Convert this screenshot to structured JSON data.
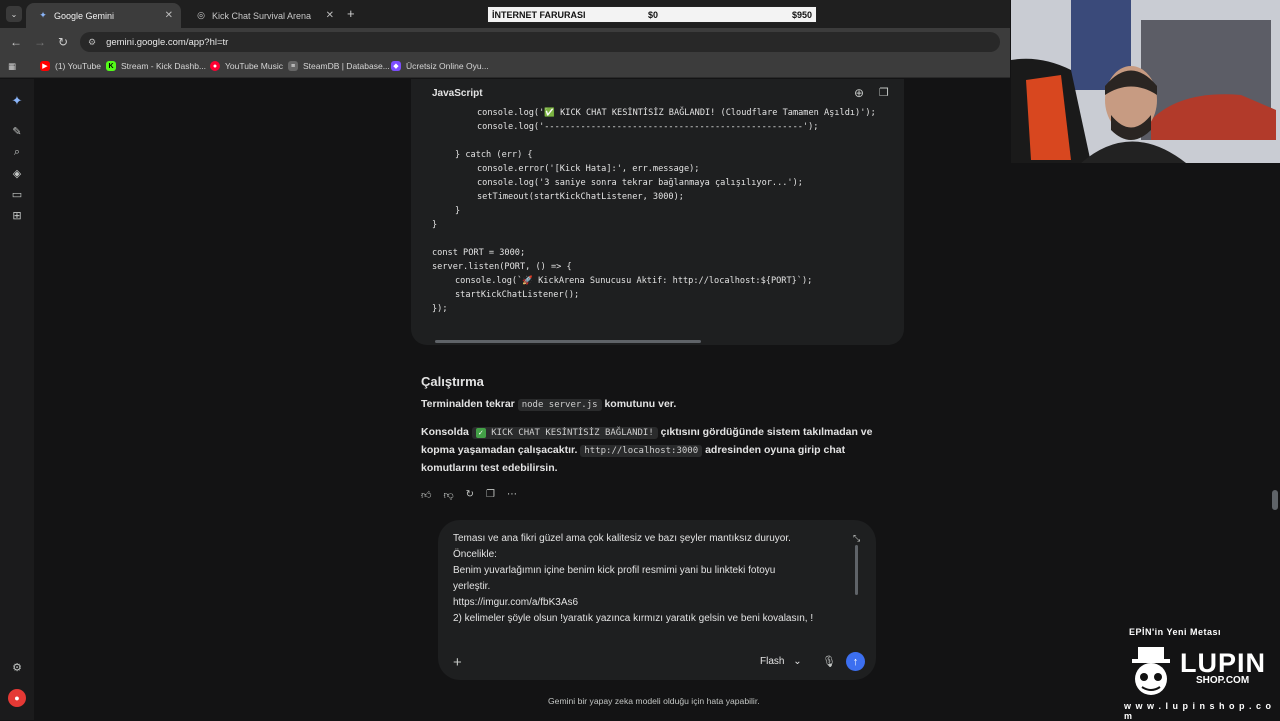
{
  "browser": {
    "tabs": [
      {
        "label": "Google Gemini",
        "active": true
      },
      {
        "label": "Kick Chat Survival Arena",
        "active": false
      }
    ],
    "url": "gemini.google.com/app?hl=tr",
    "bookmarks": [
      {
        "label": "(1) YouTube",
        "color": "#ff0000"
      },
      {
        "label": "Stream - Kick Dashb...",
        "color": "#53fc18"
      },
      {
        "label": "YouTube Music",
        "color": "#ff0033"
      },
      {
        "label": "SteamDB | Database...",
        "color": "#cccccc"
      },
      {
        "label": "Ücretsiz Online Oyu...",
        "color": "#7c4dff"
      }
    ]
  },
  "overlay_bar": {
    "label": "İNTERNET FARURASI",
    "current": "$0",
    "target": "$950"
  },
  "code_block": {
    "language": "JavaScript",
    "lines": {
      "l1": "console.log('✅ KICK CHAT KESİNTİSİZ BAĞLANDI! (Cloudflare Tamamen Aşıldı)');",
      "l2": "console.log('--------------------------------------------------');",
      "l3": "} catch (err) {",
      "l4": "console.error('[Kick Hata]:', err.message);",
      "l5": "console.log('3 saniye sonra tekrar bağlanmaya çalışılıyor...');",
      "l6": "setTimeout(startKickChatListener, 3000);",
      "l7": "}",
      "l8": "}",
      "l9": "const PORT = 3000;",
      "l10": "server.listen(PORT, () => {",
      "l11": "console.log(`🚀 KickArena Sunucusu Aktif: http://localhost:${PORT}`);",
      "l12": "startKickChatListener();",
      "l13": "});"
    }
  },
  "response": {
    "heading": "Çalıştırma",
    "p1_before": "Terminalden tekrar",
    "p1_code": "node server.js",
    "p1_after": "komutunu ver.",
    "p2_before": "Konsolda",
    "p2_code": "KICK CHAT KESİNTİSİZ BAĞLANDI!",
    "p2_mid": "çıktısını gördüğünde sistem takılmadan ve kopma yaşamadan çalışacaktır.",
    "p2_code2": "http://localhost:3000",
    "p2_after": "adresinden oyuna girip chat komutlarını test edebilirsin."
  },
  "prompt": {
    "lines": [
      "Teması ve ana fikri güzel ama çok kalitesiz ve bazı şeyler mantıksız duruyor.",
      "Öncelikle:",
      "Benim yuvarlağımın içine benim kick profil resmimi yani bu linkteki fotoyu",
      "yerleştir.",
      "https://imgur.com/a/fbK3As6",
      "2) kelimeler şöyle olsun !yaratık yazınca kırmızı yaratık gelsin ve beni kovalasın, !"
    ],
    "model": "Flash"
  },
  "disclaimer": "Gemini bir yapay zeka modeli olduğu için hata yapabilir.",
  "sponsor": {
    "tagline": "EPİN'in Yeni Metası",
    "brand": "LUPIN",
    "brand_sub": "SHOP.COM",
    "url": "w w w . l u p i n s h o p . c o m"
  },
  "colors": {
    "accent": "#3c6ff0",
    "background": "#131314",
    "card": "#1e1f20"
  }
}
